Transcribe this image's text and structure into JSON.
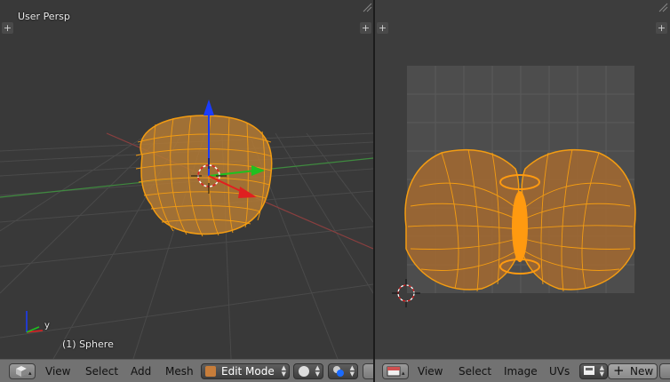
{
  "viewport3d": {
    "label": "User Persp",
    "object_label": "(1) Sphere",
    "axis_y_label": "y",
    "header": {
      "menu": [
        "View",
        "Select",
        "Add",
        "Mesh"
      ],
      "mode_label": "Edit Mode"
    }
  },
  "uv_editor": {
    "header": {
      "menu": [
        "View",
        "Select",
        "Image",
        "UVs"
      ],
      "new_label": "New"
    }
  },
  "colors": {
    "mesh_orange": "#f39c12",
    "viewport_bg": "#393939",
    "uv_bg": "#3d3d3d",
    "header_bg": "#727272",
    "x_axis": "#e02020",
    "y_axis": "#20c020",
    "z_axis": "#1a3cff"
  },
  "icons": [
    "view3d-editor-icon",
    "uv-editor-icon",
    "shading-solid-icon",
    "pivot-icon",
    "cursor-3d-icon",
    "plus-icon"
  ]
}
